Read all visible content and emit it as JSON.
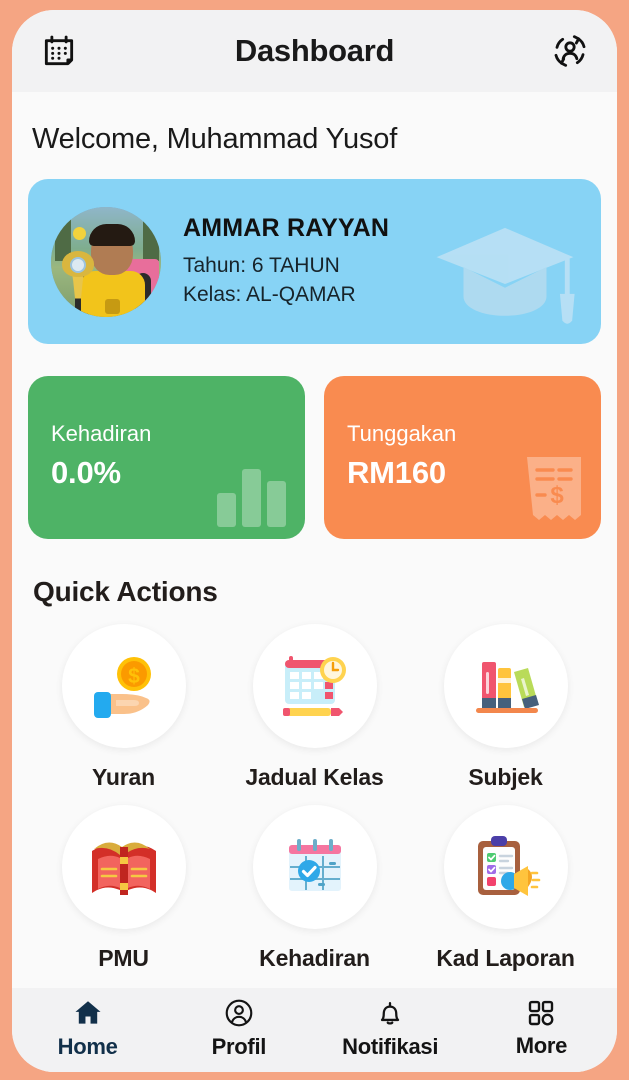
{
  "header": {
    "title": "Dashboard",
    "left_icon": "calendar-icon",
    "right_icon": "switch-user-icon"
  },
  "welcome": {
    "text": "Welcome, Muhammad Yusof"
  },
  "student_card": {
    "name": "AMMAR RAYYAN",
    "year_line": "Tahun: 6 TAHUN",
    "class_line": "Kelas: AL-QAMAR",
    "avatar_alt": "student-photo-holding-trophy",
    "watermark_icon": "graduation-cap-icon",
    "bg_color": "#87D3F5"
  },
  "stats": [
    {
      "key": "attendance",
      "label": "Kehadiran",
      "value": "0.0%",
      "color": "#4EB366",
      "watermark_icon": "bar-chart-icon"
    },
    {
      "key": "arrears",
      "label": "Tunggakan",
      "value": "RM160",
      "color": "#F98B50",
      "watermark_icon": "receipt-icon"
    }
  ],
  "quick_actions": {
    "title": "Quick Actions",
    "items": [
      {
        "label": "Yuran",
        "icon": "hand-holding-coin-icon"
      },
      {
        "label": "Jadual Kelas",
        "icon": "calendar-clock-pencil-icon"
      },
      {
        "label": "Subjek",
        "icon": "books-shelf-icon"
      },
      {
        "label": "PMU",
        "icon": "open-book-icon"
      },
      {
        "label": "Kehadiran",
        "icon": "calendar-check-icon"
      },
      {
        "label": "Kad Laporan",
        "icon": "clipboard-megaphone-icon"
      }
    ]
  },
  "bottom_nav": {
    "active_color": "#12304A",
    "items": [
      {
        "label": "Home",
        "icon": "home-icon",
        "active": true
      },
      {
        "label": "Profil",
        "icon": "user-circle-icon",
        "active": false
      },
      {
        "label": "Notifikasi",
        "icon": "bell-icon",
        "active": false
      },
      {
        "label": "More",
        "icon": "grid-squares-icon",
        "active": false
      }
    ]
  }
}
